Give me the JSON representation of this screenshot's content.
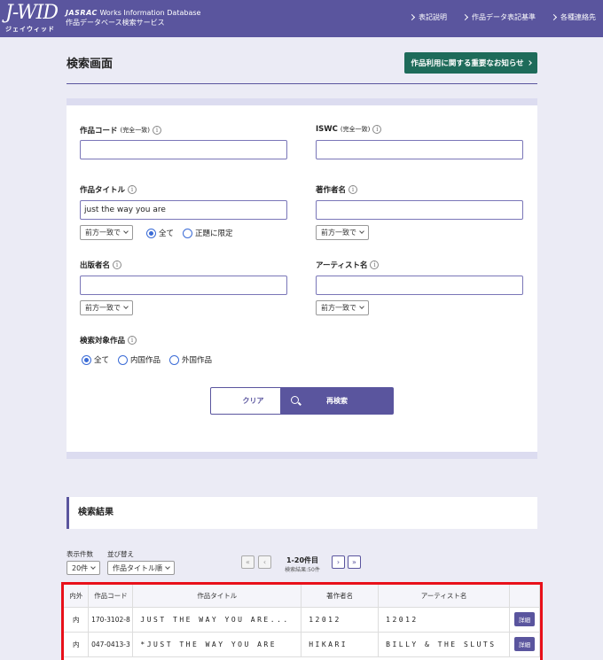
{
  "header": {
    "logo": "J-WID",
    "logo_sub": "ジェイウィッド",
    "brand_line1_logo": "JASRAC",
    "brand_line1_text": "Works Information Database",
    "brand_line2": "作品データベース検索サービス",
    "nav": [
      "表記説明",
      "作品データ表記基準",
      "各種連絡先"
    ]
  },
  "page": {
    "title": "検索画面",
    "notice_button": "作品利用に関する重要なお知らせ"
  },
  "form": {
    "work_code": {
      "label": "作品コード",
      "note": "(完全一致)",
      "value": ""
    },
    "iswc": {
      "label": "ISWC",
      "note": "(完全一致)",
      "value": ""
    },
    "work_title": {
      "label": "作品タイトル",
      "value": "just the way you are",
      "match": "前方一致で",
      "radio_all": "全て",
      "radio_main": "正題に限定"
    },
    "author": {
      "label": "著作者名",
      "value": "",
      "match": "前方一致で"
    },
    "publisher": {
      "label": "出版者名",
      "value": "",
      "match": "前方一致で"
    },
    "artist": {
      "label": "アーティスト名",
      "value": "",
      "match": "前方一致で"
    },
    "target": {
      "label": "検索対象作品",
      "options": [
        "全て",
        "内国作品",
        "外国作品"
      ]
    },
    "clear_button": "クリア",
    "search_button": "再検索"
  },
  "results": {
    "heading": "検索結果",
    "per_page_label": "表示件数",
    "per_page_value": "20件",
    "sort_label": "並び替え",
    "sort_value": "作品タイトル順",
    "range": "1-20件目",
    "total": "検索結果:50件",
    "columns": [
      "内外",
      "作品コード",
      "作品タイトル",
      "著作者名",
      "アーティスト名",
      ""
    ],
    "rows": [
      {
        "origin": "内",
        "code": "170-3102-8",
        "title": "JUST THE WAY YOU ARE...",
        "author": "12012",
        "artist": "12012",
        "action": "詳細"
      },
      {
        "origin": "内",
        "code": "047-0413-3",
        "title": "*JUST THE WAY YOU ARE",
        "author": "HIKARI",
        "artist": "BILLY & THE SLUTS",
        "action": "詳細"
      }
    ]
  }
}
